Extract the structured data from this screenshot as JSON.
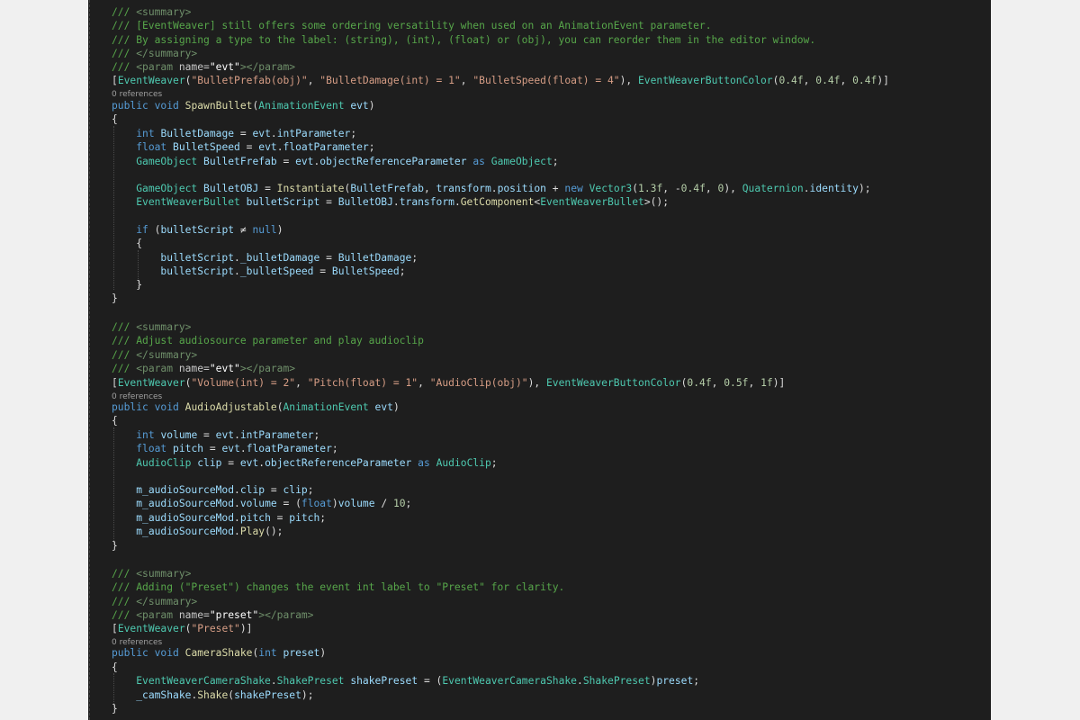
{
  "lines": [
    [
      [
        "cm",
        "/// "
      ],
      [
        "xt",
        "<summary>"
      ]
    ],
    [
      [
        "cm",
        "/// [EventWeaver] still offers some ordering versatility when used on an AnimationEvent parameter."
      ]
    ],
    [
      [
        "cm",
        "/// By assigning a type to the label: (string), (int), (float) or (obj), you can reorder them in the editor window."
      ]
    ],
    [
      [
        "cm",
        "/// "
      ],
      [
        "xt",
        "</summary>"
      ]
    ],
    [
      [
        "cm",
        "/// "
      ],
      [
        "xt",
        "<param "
      ],
      [
        "xa",
        "name="
      ],
      [
        "xv",
        "\"evt\""
      ],
      [
        "xt",
        "></param>"
      ]
    ],
    [
      [
        "pl",
        "["
      ],
      [
        "ty",
        "EventWeaver"
      ],
      [
        "pl",
        "("
      ],
      [
        "str",
        "\"BulletPrefab(obj)\""
      ],
      [
        "pl",
        ", "
      ],
      [
        "str",
        "\"BulletDamage(int) = 1\""
      ],
      [
        "pl",
        ", "
      ],
      [
        "str",
        "\"BulletSpeed(float) = 4\""
      ],
      [
        "pl",
        "), "
      ],
      [
        "ty",
        "EventWeaverButtonColor"
      ],
      [
        "pl",
        "("
      ],
      [
        "num",
        "0.4f"
      ],
      [
        "pl",
        ", "
      ],
      [
        "num",
        "0.4f"
      ],
      [
        "pl",
        ", "
      ],
      [
        "num",
        "0.4f"
      ],
      [
        "pl",
        ")]"
      ]
    ],
    [
      [
        "kw",
        "public"
      ],
      [
        "pl",
        " "
      ],
      [
        "kw",
        "void"
      ],
      [
        "pl",
        " "
      ],
      [
        "fn",
        "SpawnBullet"
      ],
      [
        "pl",
        "("
      ],
      [
        "ty",
        "AnimationEvent"
      ],
      [
        "pl",
        " "
      ],
      [
        "var",
        "evt"
      ],
      [
        "pl",
        ")"
      ]
    ],
    [
      [
        "pl",
        "{"
      ]
    ],
    [
      [
        "pl",
        "    "
      ],
      [
        "kw",
        "int"
      ],
      [
        "pl",
        " "
      ],
      [
        "var",
        "BulletDamage"
      ],
      [
        "pl",
        " = "
      ],
      [
        "var",
        "evt"
      ],
      [
        "pl",
        "."
      ],
      [
        "var",
        "intParameter"
      ],
      [
        "pl",
        ";"
      ]
    ],
    [
      [
        "pl",
        "    "
      ],
      [
        "kw",
        "float"
      ],
      [
        "pl",
        " "
      ],
      [
        "var",
        "BulletSpeed"
      ],
      [
        "pl",
        " = "
      ],
      [
        "var",
        "evt"
      ],
      [
        "pl",
        "."
      ],
      [
        "var",
        "floatParameter"
      ],
      [
        "pl",
        ";"
      ]
    ],
    [
      [
        "pl",
        "    "
      ],
      [
        "ty",
        "GameObject"
      ],
      [
        "pl",
        " "
      ],
      [
        "var",
        "BulletFrefab"
      ],
      [
        "pl",
        " = "
      ],
      [
        "var",
        "evt"
      ],
      [
        "pl",
        "."
      ],
      [
        "var",
        "objectReferenceParameter"
      ],
      [
        "pl",
        " "
      ],
      [
        "kw",
        "as"
      ],
      [
        "pl",
        " "
      ],
      [
        "ty",
        "GameObject"
      ],
      [
        "pl",
        ";"
      ]
    ],
    [
      [
        "pl",
        "    "
      ],
      [
        "ty",
        "GameObject"
      ],
      [
        "pl",
        " "
      ],
      [
        "var",
        "BulletOBJ"
      ],
      [
        "pl",
        " = "
      ],
      [
        "fn",
        "Instantiate"
      ],
      [
        "pl",
        "("
      ],
      [
        "var",
        "BulletFrefab"
      ],
      [
        "pl",
        ", "
      ],
      [
        "var",
        "transform"
      ],
      [
        "pl",
        "."
      ],
      [
        "var",
        "position"
      ],
      [
        "pl",
        " + "
      ],
      [
        "kw",
        "new"
      ],
      [
        "pl",
        " "
      ],
      [
        "ty",
        "Vector3"
      ],
      [
        "pl",
        "("
      ],
      [
        "num",
        "1.3f"
      ],
      [
        "pl",
        ", -"
      ],
      [
        "num",
        "0.4f"
      ],
      [
        "pl",
        ", "
      ],
      [
        "num",
        "0"
      ],
      [
        "pl",
        "), "
      ],
      [
        "ty",
        "Quaternion"
      ],
      [
        "pl",
        "."
      ],
      [
        "var",
        "identity"
      ],
      [
        "pl",
        ");"
      ]
    ],
    [
      [
        "pl",
        "    "
      ],
      [
        "ty",
        "EventWeaverBullet"
      ],
      [
        "pl",
        " "
      ],
      [
        "var",
        "bulletScript"
      ],
      [
        "pl",
        " = "
      ],
      [
        "var",
        "BulletOBJ"
      ],
      [
        "pl",
        "."
      ],
      [
        "var",
        "transform"
      ],
      [
        "pl",
        "."
      ],
      [
        "fn",
        "GetComponent"
      ],
      [
        "pl",
        "<"
      ],
      [
        "ty",
        "EventWeaverBullet"
      ],
      [
        "pl",
        ">();"
      ]
    ],
    [
      [
        "pl",
        "    "
      ],
      [
        "kw",
        "if"
      ],
      [
        "pl",
        " ("
      ],
      [
        "var",
        "bulletScript"
      ],
      [
        "pl",
        " ≠ "
      ],
      [
        "kw",
        "null"
      ],
      [
        "pl",
        ")"
      ]
    ],
    [
      [
        "pl",
        "    {"
      ]
    ],
    [
      [
        "pl",
        "        "
      ],
      [
        "var",
        "bulletScript"
      ],
      [
        "pl",
        "."
      ],
      [
        "var",
        "_bulletDamage"
      ],
      [
        "pl",
        " = "
      ],
      [
        "var",
        "BulletDamage"
      ],
      [
        "pl",
        ";"
      ]
    ],
    [
      [
        "pl",
        "        "
      ],
      [
        "var",
        "bulletScript"
      ],
      [
        "pl",
        "."
      ],
      [
        "var",
        "_bulletSpeed"
      ],
      [
        "pl",
        " = "
      ],
      [
        "var",
        "BulletSpeed"
      ],
      [
        "pl",
        ";"
      ]
    ],
    [
      [
        "pl",
        "    }"
      ]
    ],
    [
      [
        "pl",
        "}"
      ]
    ],
    [
      [
        "cm",
        "/// "
      ],
      [
        "xt",
        "<summary>"
      ]
    ],
    [
      [
        "cm",
        "/// Adjust audiosource parameter and play audioclip"
      ]
    ],
    [
      [
        "cm",
        "/// "
      ],
      [
        "xt",
        "</summary>"
      ]
    ],
    [
      [
        "cm",
        "/// "
      ],
      [
        "xt",
        "<param "
      ],
      [
        "xa",
        "name="
      ],
      [
        "xv",
        "\"evt\""
      ],
      [
        "xt",
        "></param>"
      ]
    ],
    [
      [
        "pl",
        "["
      ],
      [
        "ty",
        "EventWeaver"
      ],
      [
        "pl",
        "("
      ],
      [
        "str",
        "\"Volume(int) = 2\""
      ],
      [
        "pl",
        ", "
      ],
      [
        "str",
        "\"Pitch(float) = 1\""
      ],
      [
        "pl",
        ", "
      ],
      [
        "str",
        "\"AudioClip(obj)\""
      ],
      [
        "pl",
        "), "
      ],
      [
        "ty",
        "EventWeaverButtonColor"
      ],
      [
        "pl",
        "("
      ],
      [
        "num",
        "0.4f"
      ],
      [
        "pl",
        ", "
      ],
      [
        "num",
        "0.5f"
      ],
      [
        "pl",
        ", "
      ],
      [
        "num",
        "1f"
      ],
      [
        "pl",
        ")]"
      ]
    ],
    [
      [
        "kw",
        "public"
      ],
      [
        "pl",
        " "
      ],
      [
        "kw",
        "void"
      ],
      [
        "pl",
        " "
      ],
      [
        "fn",
        "AudioAdjustable"
      ],
      [
        "pl",
        "("
      ],
      [
        "ty",
        "AnimationEvent"
      ],
      [
        "pl",
        " "
      ],
      [
        "var",
        "evt"
      ],
      [
        "pl",
        ")"
      ]
    ],
    [
      [
        "pl",
        "{"
      ]
    ],
    [
      [
        "pl",
        "    "
      ],
      [
        "kw",
        "int"
      ],
      [
        "pl",
        " "
      ],
      [
        "var",
        "volume"
      ],
      [
        "pl",
        " = "
      ],
      [
        "var",
        "evt"
      ],
      [
        "pl",
        "."
      ],
      [
        "var",
        "intParameter"
      ],
      [
        "pl",
        ";"
      ]
    ],
    [
      [
        "pl",
        "    "
      ],
      [
        "kw",
        "float"
      ],
      [
        "pl",
        " "
      ],
      [
        "var",
        "pitch"
      ],
      [
        "pl",
        " = "
      ],
      [
        "var",
        "evt"
      ],
      [
        "pl",
        "."
      ],
      [
        "var",
        "floatParameter"
      ],
      [
        "pl",
        ";"
      ]
    ],
    [
      [
        "pl",
        "    "
      ],
      [
        "ty",
        "AudioClip"
      ],
      [
        "pl",
        " "
      ],
      [
        "var",
        "clip"
      ],
      [
        "pl",
        " = "
      ],
      [
        "var",
        "evt"
      ],
      [
        "pl",
        "."
      ],
      [
        "var",
        "objectReferenceParameter"
      ],
      [
        "pl",
        " "
      ],
      [
        "kw",
        "as"
      ],
      [
        "pl",
        " "
      ],
      [
        "ty",
        "AudioClip"
      ],
      [
        "pl",
        ";"
      ]
    ],
    [
      [
        "pl",
        "    "
      ],
      [
        "var",
        "m_audioSourceMod"
      ],
      [
        "pl",
        "."
      ],
      [
        "var",
        "clip"
      ],
      [
        "pl",
        " = "
      ],
      [
        "var",
        "clip"
      ],
      [
        "pl",
        ";"
      ]
    ],
    [
      [
        "pl",
        "    "
      ],
      [
        "var",
        "m_audioSourceMod"
      ],
      [
        "pl",
        "."
      ],
      [
        "var",
        "volume"
      ],
      [
        "pl",
        " = ("
      ],
      [
        "kw",
        "float"
      ],
      [
        "pl",
        ")"
      ],
      [
        "var",
        "volume"
      ],
      [
        "pl",
        " / "
      ],
      [
        "num",
        "10"
      ],
      [
        "pl",
        ";"
      ]
    ],
    [
      [
        "pl",
        "    "
      ],
      [
        "var",
        "m_audioSourceMod"
      ],
      [
        "pl",
        "."
      ],
      [
        "var",
        "pitch"
      ],
      [
        "pl",
        " = "
      ],
      [
        "var",
        "pitch"
      ],
      [
        "pl",
        ";"
      ]
    ],
    [
      [
        "pl",
        "    "
      ],
      [
        "var",
        "m_audioSourceMod"
      ],
      [
        "pl",
        "."
      ],
      [
        "fn",
        "Play"
      ],
      [
        "pl",
        "();"
      ]
    ],
    [
      [
        "pl",
        "}"
      ]
    ],
    [
      [
        "cm",
        "/// "
      ],
      [
        "xt",
        "<summary>"
      ]
    ],
    [
      [
        "cm",
        "/// Adding (\"Preset\") changes the event int label to \"Preset\" for clarity."
      ]
    ],
    [
      [
        "cm",
        "/// "
      ],
      [
        "xt",
        "</summary>"
      ]
    ],
    [
      [
        "cm",
        "/// "
      ],
      [
        "xt",
        "<param "
      ],
      [
        "xa",
        "name="
      ],
      [
        "xv",
        "\"preset\""
      ],
      [
        "xt",
        "></param>"
      ]
    ],
    [
      [
        "pl",
        "["
      ],
      [
        "ty",
        "EventWeaver"
      ],
      [
        "pl",
        "("
      ],
      [
        "str",
        "\"Preset\""
      ],
      [
        "pl",
        ")]"
      ]
    ],
    [
      [
        "kw",
        "public"
      ],
      [
        "pl",
        " "
      ],
      [
        "kw",
        "void"
      ],
      [
        "pl",
        " "
      ],
      [
        "fn",
        "CameraShake"
      ],
      [
        "pl",
        "("
      ],
      [
        "kw",
        "int"
      ],
      [
        "pl",
        " "
      ],
      [
        "var",
        "preset"
      ],
      [
        "pl",
        ")"
      ]
    ],
    [
      [
        "pl",
        "{"
      ]
    ],
    [
      [
        "pl",
        "    "
      ],
      [
        "ty",
        "EventWeaverCameraShake"
      ],
      [
        "pl",
        "."
      ],
      [
        "ty",
        "ShakePreset"
      ],
      [
        "pl",
        " "
      ],
      [
        "var",
        "shakePreset"
      ],
      [
        "pl",
        " = ("
      ],
      [
        "ty",
        "EventWeaverCameraShake"
      ],
      [
        "pl",
        "."
      ],
      [
        "ty",
        "ShakePreset"
      ],
      [
        "pl",
        ")"
      ],
      [
        "var",
        "preset"
      ],
      [
        "pl",
        ";"
      ]
    ],
    [
      [
        "pl",
        "    "
      ],
      [
        "var",
        "_camShake"
      ],
      [
        "pl",
        "."
      ],
      [
        "fn",
        "Shake"
      ],
      [
        "pl",
        "("
      ],
      [
        "var",
        "shakePreset"
      ],
      [
        "pl",
        ");"
      ]
    ],
    [
      [
        "pl",
        "}"
      ]
    ]
  ],
  "codelens": {
    "spawn_bullet": "0 references",
    "audio_adjustable": "0 references",
    "camera_shake": "0 references"
  }
}
